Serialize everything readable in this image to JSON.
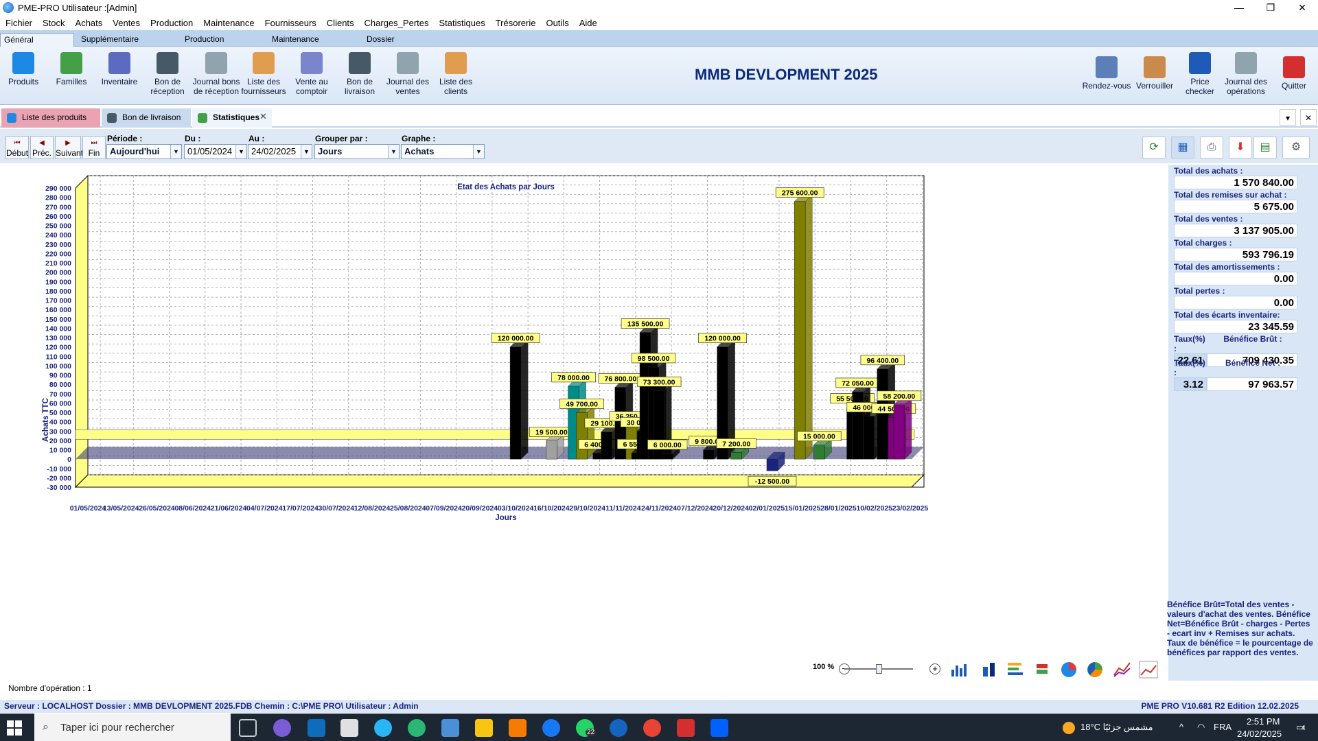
{
  "window": {
    "title": "PME-PRO  Utilisateur :[Admin]",
    "minimize": "—",
    "maximize": "❐",
    "close": "✕"
  },
  "menu": [
    "Fichier",
    "Stock",
    "Achats",
    "Ventes",
    "Production",
    "Maintenance",
    "Fournisseurs",
    "Clients",
    "Charges_Pertes",
    "Statistiques",
    "Trésorerie",
    "Outils",
    "Aide"
  ],
  "ribbon_tabs": [
    "Général",
    "Supplémentaire",
    "Production",
    "Maintenance",
    "Dossier"
  ],
  "ribbon_left": [
    {
      "label": "Produits",
      "icon": "cube-icon",
      "color": "#1e88e5"
    },
    {
      "label": "Familles",
      "icon": "cubes-icon",
      "color": "#43a047"
    },
    {
      "label": "Inventaire",
      "icon": "inventory-icon",
      "color": "#5c6bc0"
    },
    {
      "label": "Bon de réception",
      "icon": "receipt-icon",
      "color": "#455a64"
    },
    {
      "label": "Journal bons de réception",
      "icon": "journal-icon",
      "color": "#90a4ae"
    },
    {
      "label": "Liste des fournisseurs",
      "icon": "supplier-icon",
      "color": "#e09c4f"
    },
    {
      "label": "Vente au comptoir",
      "icon": "cash-register-icon",
      "color": "#7986cb"
    },
    {
      "label": "Bon de livraison",
      "icon": "delivery-icon",
      "color": "#455a64"
    },
    {
      "label": "Journal des ventes",
      "icon": "journal-icon",
      "color": "#90a4ae"
    },
    {
      "label": "Liste des clients",
      "icon": "client-icon",
      "color": "#e09c4f"
    }
  ],
  "ribbon_right": [
    {
      "label": "Rendez-vous",
      "icon": "calendar-icon",
      "color": "#5c7fb8"
    },
    {
      "label": "Verrouiller",
      "icon": "lock-users-icon",
      "color": "#c98a4b"
    },
    {
      "label": "Price checker",
      "icon": "monitor-icon",
      "color": "#1e5bb8"
    },
    {
      "label": "Journal des opérations",
      "icon": "journal-icon",
      "color": "#90a4ae"
    },
    {
      "label": "Quitter",
      "icon": "power-icon",
      "color": "#d32f2f"
    }
  ],
  "company": "MMB DEVLOPMENT 2025",
  "doc_tabs": [
    "Liste des produits",
    "Bon de livraison",
    "Statistiques"
  ],
  "nav": [
    "Début",
    "Préc.",
    "Suivant",
    "Fin"
  ],
  "filters": {
    "periode": {
      "label": "Période :",
      "value": "Aujourd'hui"
    },
    "du": {
      "label": "Du :",
      "value": "01/05/2024"
    },
    "au": {
      "label": "Au :",
      "value": "24/02/2025"
    },
    "grouper": {
      "label": "Grouper par :",
      "value": "Jours"
    },
    "graphe": {
      "label": "Graphe :",
      "value": "Achats"
    }
  },
  "totals": [
    {
      "label": "Total des achats :",
      "value": "1 570 840.00"
    },
    {
      "label": "Total des remises sur achat :",
      "value": "5 675.00"
    },
    {
      "label": "Total des ventes :",
      "value": "3 137 905.00"
    },
    {
      "label": "Total charges :",
      "value": "593 796.19"
    },
    {
      "label": "Total des amortissements :",
      "value": "0.00"
    },
    {
      "label": "Total pertes :",
      "value": "0.00"
    },
    {
      "label": "Total des écarts inventaire:",
      "value": "23 345.59"
    }
  ],
  "benefits": [
    {
      "taux_label": "Taux(%) :",
      "taux": "22.61",
      "label": "Bénéfice Brût :",
      "value": "709 430.35"
    },
    {
      "taux_label": "Taux(%) :",
      "taux": "3.12",
      "label": "Bénéfice Net :",
      "value": "97 963.57"
    }
  ],
  "legend_note": "Bénéfice Brût=Total des ventes - valeurs d'achat des ventes. Bénéfice Net=Bénéfice Brût - charges - Pertes - ecart inv + Remises sur achats. Taux de bénéfice = le pourcentage de bénéfices par rapport des ventes.",
  "zoom": "100 %",
  "op_count": "Nombre d'opération :   1",
  "status_left": "Serveur : LOCALHOST  Dossier : MMB DEVLOPMENT 2025.FDB Chemin : C:\\PME PRO\\  Utilisateur : Admin",
  "status_right": "PME PRO V10.681 R2 Edition 12.02.2025",
  "taskbar": {
    "search": "Taper ici pour rechercher",
    "weather": "18°C  مشمس جزئيًا",
    "lang": "FRA",
    "time": "2:51 PM",
    "date": "24/02/2025",
    "badge": "22",
    "notif": "4"
  },
  "chart_data": {
    "type": "bar",
    "title": "Etat des Achats par Jours",
    "xlabel": "Jours",
    "ylabel": "Achats TTC",
    "ylim": [
      -30000,
      290000
    ],
    "ytick_step": 10000,
    "x_tick_labels": [
      "01/05/2024",
      "13/05/2024",
      "26/05/2024",
      "08/06/2024",
      "21/06/2024",
      "04/07/2024",
      "17/07/2024",
      "30/07/2024",
      "12/08/2024",
      "25/08/2024",
      "07/09/2024",
      "20/09/2024",
      "03/10/2024",
      "16/10/2024",
      "29/10/2024",
      "11/11/2024",
      "24/11/2024",
      "07/12/2024",
      "20/12/2024",
      "02/01/2025",
      "15/01/2025",
      "28/01/2025",
      "10/02/2025",
      "23/02/2025"
    ],
    "grid": true,
    "style": "3d",
    "bars": [
      {
        "date": "03/10/2024",
        "value": 120000,
        "label": "120 000.00",
        "color": "#000000"
      },
      {
        "date": "16/10/2024",
        "value": 19500,
        "label": "19 500.00",
        "color": "#a0a0a0"
      },
      {
        "date": "24/10/2024",
        "value": 78000,
        "label": "78 000.00",
        "color": "#008b8b"
      },
      {
        "date": "27/10/2024",
        "value": 49700,
        "label": "49 700.00",
        "color": "#808000"
      },
      {
        "date": "02/11/2024",
        "value": 6400,
        "label": "6 400.00",
        "color": "#000000"
      },
      {
        "date": "05/11/2024",
        "value": 29100,
        "label": "29 100.00",
        "color": "#000000"
      },
      {
        "date": "10/11/2024",
        "value": 76800,
        "label": "76 800.00",
        "color": "#000000"
      },
      {
        "date": "14/11/2024",
        "value": 36250,
        "label": "36 250.00",
        "color": "#808000"
      },
      {
        "date": "16/11/2024",
        "value": 6550,
        "label": "6 550.00",
        "color": "#000000"
      },
      {
        "date": "18/11/2024",
        "value": 30000,
        "label": "30 000.00",
        "color": "#000000"
      },
      {
        "date": "19/11/2024",
        "value": 135500,
        "label": "135 500.00",
        "color": "#000000"
      },
      {
        "date": "22/11/2024",
        "value": 98500,
        "label": "98 500.00",
        "color": "#000000"
      },
      {
        "date": "24/11/2024",
        "value": 73300,
        "label": "73 300.00",
        "color": "#000000"
      },
      {
        "date": "27/11/2024",
        "value": 6000,
        "label": "6 000.00",
        "color": "#000000"
      },
      {
        "date": "12/12/2024",
        "value": 9800,
        "label": "9 800.00",
        "color": "#000000"
      },
      {
        "date": "17/12/2024",
        "value": 120000,
        "label": "120 000.00",
        "color": "#000000"
      },
      {
        "date": "22/12/2024",
        "value": 7200,
        "label": "7 200.00",
        "color": "#2e7d32"
      },
      {
        "date": "04/01/2025",
        "value": -12500,
        "label": "-12 500.00",
        "color": "#1a237e"
      },
      {
        "date": "14/01/2025",
        "value": 275600,
        "label": "275 600.00",
        "color": "#808000"
      },
      {
        "date": "21/01/2025",
        "value": 15000,
        "label": "15 000.00",
        "color": "#2e7d32"
      },
      {
        "date": "02/02/2025",
        "value": 55500,
        "label": "55 500.00",
        "color": "#000000"
      },
      {
        "date": "04/02/2025",
        "value": 72050,
        "label": "72 050.00",
        "color": "#000000"
      },
      {
        "date": "08/02/2025",
        "value": 46000,
        "label": "46 000.00",
        "color": "#000000"
      },
      {
        "date": "13/02/2025",
        "value": 96400,
        "label": "96 400.00",
        "color": "#000000"
      },
      {
        "date": "17/02/2025",
        "value": 44500,
        "label": "44 500.00",
        "color": "#800080"
      },
      {
        "date": "19/02/2025",
        "value": 58200,
        "label": "58 200.00",
        "color": "#800080"
      }
    ]
  }
}
